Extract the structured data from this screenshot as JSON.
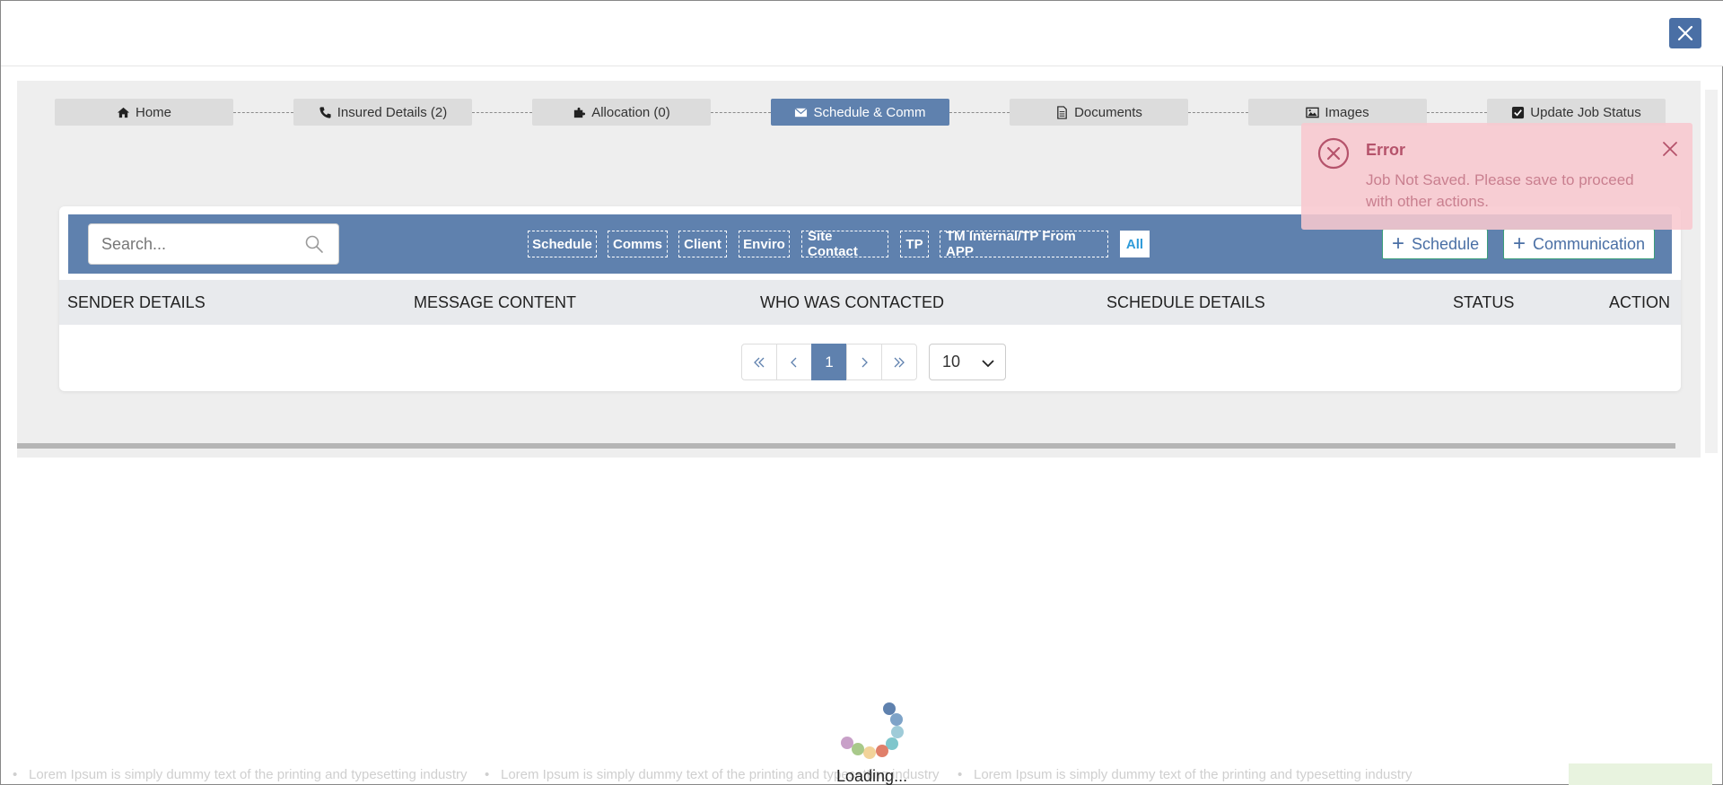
{
  "stepper": {
    "steps": [
      {
        "label": "Home",
        "icon": "home-icon",
        "active": false
      },
      {
        "label": "Insured Details (2)",
        "icon": "phone-icon",
        "active": false
      },
      {
        "label": "Allocation (0)",
        "icon": "puzzle-icon",
        "active": false
      },
      {
        "label": "Schedule & Comm",
        "icon": "envelope-icon",
        "active": true
      },
      {
        "label": "Documents",
        "icon": "document-icon",
        "active": false
      },
      {
        "label": "Images",
        "icon": "image-icon",
        "active": false
      },
      {
        "label": "Update Job Status",
        "icon": "checkbox-icon",
        "active": false
      }
    ]
  },
  "search": {
    "placeholder": "Search..."
  },
  "filters": [
    "Schedule",
    "Comms",
    "Client",
    "Enviro",
    "Site Contact",
    "TP",
    "TM Internal/TP From APP",
    "All"
  ],
  "active_filter": "All",
  "actions": {
    "add_schedule": "Schedule",
    "add_communication": "Communication"
  },
  "table": {
    "columns": [
      "SENDER DETAILS",
      "MESSAGE CONTENT",
      "WHO WAS CONTACTED",
      "SCHEDULE DETAILS",
      "STATUS",
      "ACTION"
    ]
  },
  "pagination": {
    "current_page": "1",
    "page_size": "10"
  },
  "toast": {
    "title": "Error",
    "message": "Job Not Saved. Please save to proceed with other actions."
  },
  "ticker": {
    "items": [
      "Lorem Ipsum is simply dummy text of the printing and typesetting industry",
      "Lorem Ipsum is simply dummy text of the printing and typesetting industry",
      "Lorem Ipsum is simply dummy text of the printing and typesetting industry"
    ]
  },
  "loading_text": "Loading...",
  "colors": {
    "primary": "#5f81ae",
    "close": "#4a6fa5",
    "error_bg": "#f8c8cf",
    "error_text": "#b5536b"
  }
}
